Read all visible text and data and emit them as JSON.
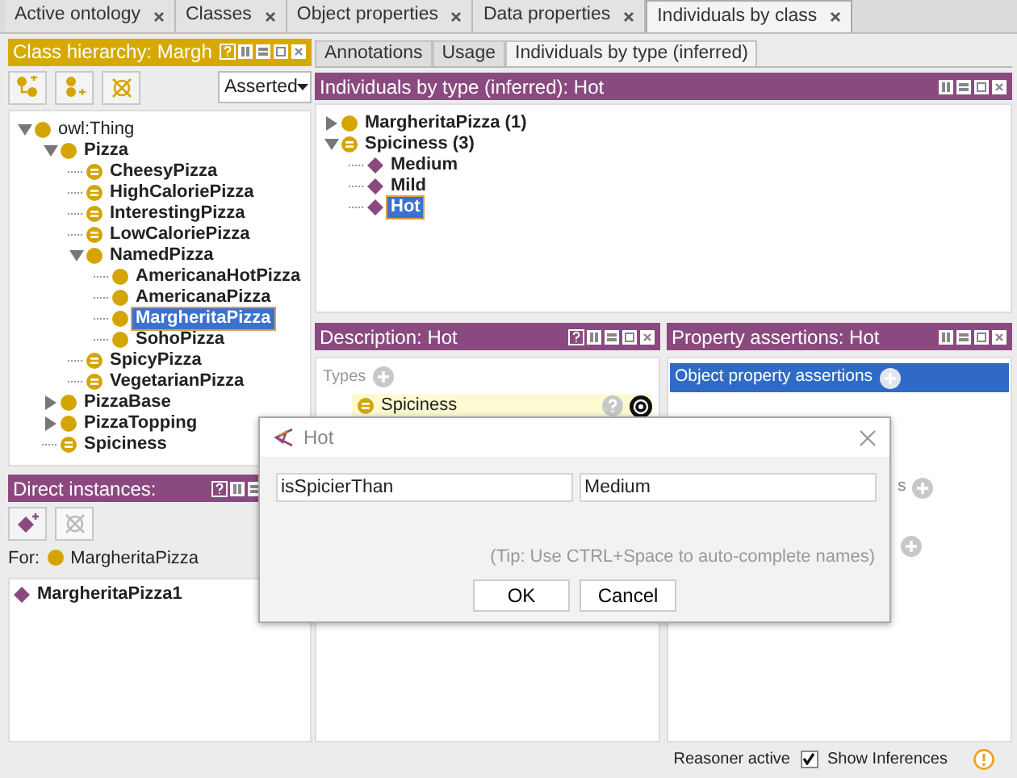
{
  "tabs": [
    {
      "label": "Active ontology",
      "selected": false
    },
    {
      "label": "Classes",
      "selected": false
    },
    {
      "label": "Object properties",
      "selected": false
    },
    {
      "label": "Data properties",
      "selected": false
    },
    {
      "label": "Individuals by class",
      "selected": true
    }
  ],
  "class_hierarchy": {
    "title": "Class hierarchy: Margh",
    "toolbar": [
      {
        "kind": "add-subclass",
        "disabled": false
      },
      {
        "kind": "add-sibling",
        "disabled": false
      },
      {
        "kind": "delete",
        "disabled": false
      }
    ],
    "mode": "Asserted",
    "tree": [
      {
        "label": "owl:Thing",
        "kind": "class",
        "expanded": true,
        "selected": false,
        "children": [
          {
            "label": "Pizza",
            "kind": "class",
            "expanded": true,
            "selected": false,
            "children": [
              {
                "label": "CheesyPizza",
                "kind": "defined",
                "selected": false
              },
              {
                "label": "HighCaloriePizza",
                "kind": "defined",
                "selected": false
              },
              {
                "label": "InterestingPizza",
                "kind": "defined",
                "selected": false
              },
              {
                "label": "LowCaloriePizza",
                "kind": "defined",
                "selected": false
              },
              {
                "label": "NamedPizza",
                "kind": "class",
                "expanded": true,
                "selected": false,
                "children": [
                  {
                    "label": "AmericanaHotPizza",
                    "kind": "class",
                    "selected": false
                  },
                  {
                    "label": "AmericanaPizza",
                    "kind": "class",
                    "selected": false
                  },
                  {
                    "label": "MargheritaPizza",
                    "kind": "class",
                    "selected": true
                  },
                  {
                    "label": "SohoPizza",
                    "kind": "class",
                    "selected": false
                  }
                ]
              },
              {
                "label": "SpicyPizza",
                "kind": "defined",
                "selected": false
              },
              {
                "label": "VegetarianPizza",
                "kind": "defined",
                "selected": false
              }
            ]
          },
          {
            "label": "PizzaBase",
            "kind": "class",
            "expanded": false,
            "selected": false
          },
          {
            "label": "PizzaTopping",
            "kind": "class",
            "expanded": false,
            "selected": false
          },
          {
            "label": "Spiciness",
            "kind": "defined",
            "selected": false
          }
        ]
      }
    ]
  },
  "direct_instances": {
    "title": "Direct instances:",
    "toolbar": [
      {
        "kind": "add-individual",
        "disabled": false
      },
      {
        "kind": "delete",
        "disabled": true
      }
    ],
    "for_label": "For:",
    "for_class": "MargheritaPizza",
    "items": [
      {
        "label": "MargheritaPizza1",
        "selected": false
      }
    ]
  },
  "subtabs": [
    {
      "label": "Annotations",
      "selected": false
    },
    {
      "label": "Usage",
      "selected": false
    },
    {
      "label": "Individuals by type (inferred)",
      "selected": true
    }
  ],
  "individuals_by_type": {
    "title": "Individuals by type (inferred): Hot",
    "tree": [
      {
        "label": "MargheritaPizza (1)",
        "kind": "class",
        "expanded": false,
        "selected": false
      },
      {
        "label": "Spiciness (3)",
        "kind": "defined",
        "expanded": true,
        "selected": false,
        "children": [
          {
            "label": "Medium",
            "kind": "individual",
            "selected": false
          },
          {
            "label": "Mild",
            "kind": "individual",
            "selected": false
          },
          {
            "label": "Hot",
            "kind": "individual",
            "selected": true
          }
        ]
      }
    ]
  },
  "description": {
    "title": "Description: Hot",
    "types_label": "Types",
    "types": [
      {
        "label": "Spiciness"
      }
    ]
  },
  "property_assertions": {
    "title": "Property assertions: Hot",
    "sections": [
      {
        "label": "Object property assertions",
        "selected": true
      },
      {
        "label": "s",
        "selected": false
      },
      {
        "selected": false
      }
    ]
  },
  "dialog": {
    "title": "Hot",
    "property": "isSpicierThan",
    "value": "Medium",
    "tip": "(Tip: Use CTRL+Space to auto-complete names)",
    "buttons": [
      "OK",
      "Cancel"
    ]
  },
  "status_bar": {
    "reasoner": "Reasoner active",
    "show_inferences": {
      "label": "Show Inferences",
      "checked": true
    }
  }
}
